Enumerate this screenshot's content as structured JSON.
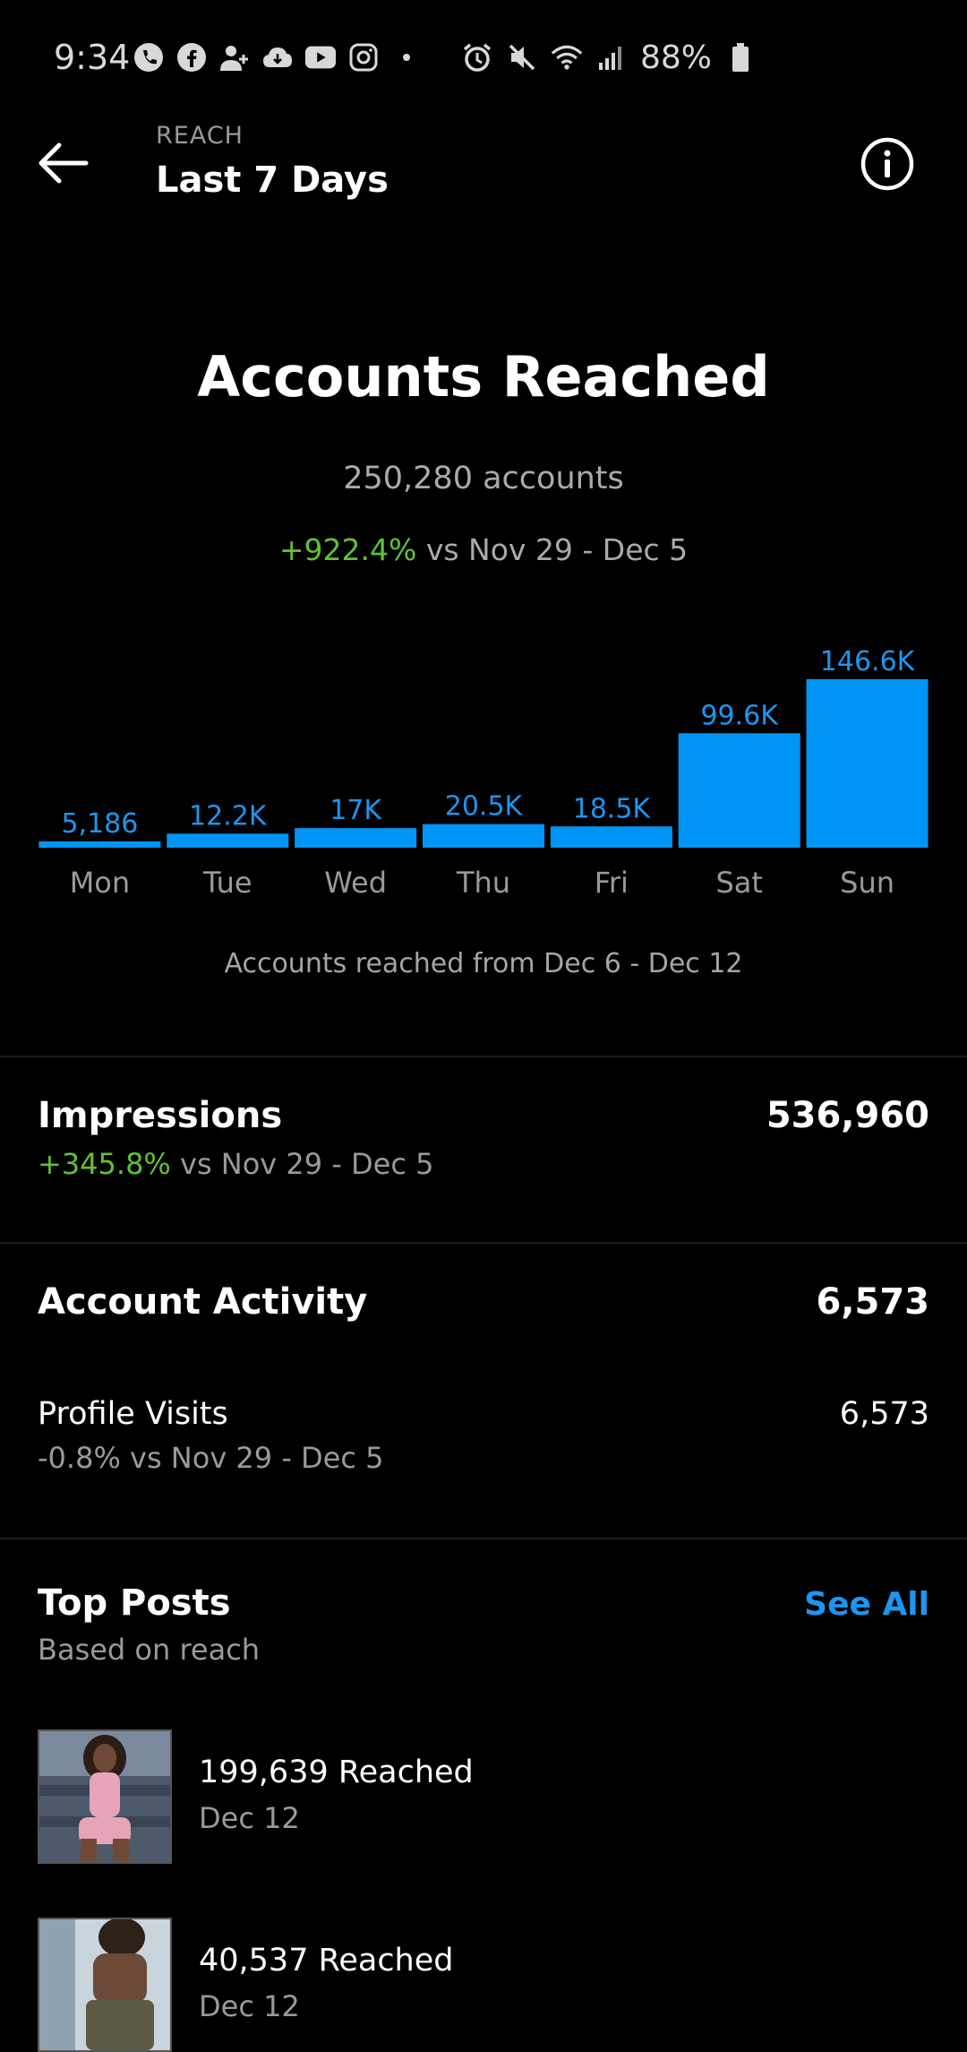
{
  "status_bar": {
    "time": "9:34",
    "battery": "88%",
    "left_icons": [
      "phone-icon",
      "facebook-icon",
      "add-user-icon",
      "cloud-icon",
      "youtube-icon",
      "instagram-icon",
      "dot-icon"
    ],
    "right_icons": [
      "alarm-icon",
      "mute-icon",
      "wifi-icon",
      "signal-icon",
      "battery-icon"
    ]
  },
  "header": {
    "label": "REACH",
    "title": "Last 7 Days"
  },
  "reach": {
    "heading": "Accounts Reached",
    "count": "250,280 accounts",
    "change": "+922.4%",
    "change_compare": " vs Nov 29 - Dec 5",
    "note": "Accounts reached from Dec 6 - Dec 12"
  },
  "chart_data": {
    "type": "bar",
    "categories": [
      "Mon",
      "Tue",
      "Wed",
      "Thu",
      "Fri",
      "Sat",
      "Sun"
    ],
    "values": [
      5186,
      12200,
      17000,
      20500,
      18500,
      99600,
      146600
    ],
    "value_labels": [
      "5,186",
      "12.2K",
      "17K",
      "20.5K",
      "18.5K",
      "99.6K",
      "146.6K"
    ],
    "bar_color": "#0094f5",
    "label_color": "#1c96f0",
    "tick_color": "#9a9a9a",
    "ylim": [
      0,
      146600
    ]
  },
  "impressions": {
    "title": "Impressions",
    "value": "536,960",
    "change": "+345.8%",
    "change_compare": " vs Nov 29 - Dec 5"
  },
  "account_activity": {
    "title": "Account Activity",
    "value": "6,573",
    "profile_visits_label": "Profile Visits",
    "profile_visits_value": "6,573",
    "profile_visits_change": "-0.8% vs Nov 29 - Dec 5"
  },
  "top_posts": {
    "title": "Top Posts",
    "subtitle": "Based on reach",
    "see_all": "See All",
    "posts": [
      {
        "reach": "199,639 Reached",
        "date": "Dec 12"
      },
      {
        "reach": "40,537 Reached",
        "date": "Dec 12"
      }
    ]
  },
  "colors": {
    "accent": "#1c96f0",
    "positive": "#5ec432",
    "background": "#000000"
  }
}
